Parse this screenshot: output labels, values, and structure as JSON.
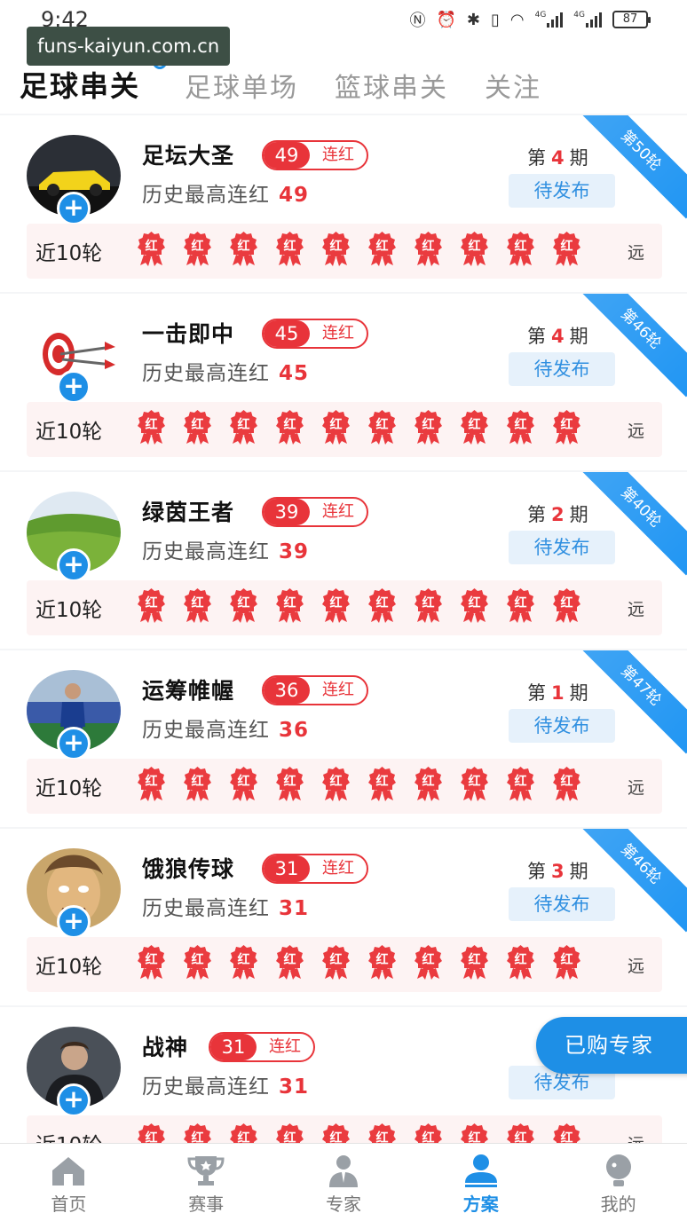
{
  "status_bar": {
    "time": "9:42",
    "battery": "87",
    "net1": "4G",
    "net2": "4G"
  },
  "watermark": "funs-kaiyun.com.cn",
  "tabs": [
    {
      "label": "足球串关",
      "active": true
    },
    {
      "label": "足球单场",
      "active": false
    },
    {
      "label": "篮球串关",
      "active": false
    },
    {
      "label": "关注",
      "active": false
    }
  ],
  "common": {
    "streak_label": "连红",
    "history_label": "历史最高连红",
    "period_prefix": "第",
    "period_suffix": "期",
    "publish_label": "待发布",
    "recent_label": "近10轮",
    "medal_text": "红",
    "far_label": "远",
    "add_symbol": "+"
  },
  "experts": [
    {
      "name": "足坛大圣",
      "streak": "49",
      "history_max": "49",
      "period": "4",
      "round": "第50轮",
      "avatar": "car"
    },
    {
      "name": "一击即中",
      "streak": "45",
      "history_max": "45",
      "period": "4",
      "round": "第46轮",
      "avatar": "target"
    },
    {
      "name": "绿茵王者",
      "streak": "39",
      "history_max": "39",
      "period": "2",
      "round": "第40轮",
      "avatar": "field"
    },
    {
      "name": "运筹帷幄",
      "streak": "36",
      "history_max": "36",
      "period": "1",
      "round": "第47轮",
      "avatar": "player"
    },
    {
      "name": "饿狼传球",
      "streak": "31",
      "history_max": "31",
      "period": "3",
      "round": "第46轮",
      "avatar": "cartoon"
    },
    {
      "name": "战神",
      "streak": "31",
      "history_max": "31",
      "period": "",
      "round": "",
      "avatar": "man"
    }
  ],
  "float_button": "已购专家",
  "nav": [
    {
      "label": "首页",
      "icon": "home-icon",
      "active": false
    },
    {
      "label": "赛事",
      "icon": "trophy-icon",
      "active": false
    },
    {
      "label": "专家",
      "icon": "expert-icon",
      "active": false
    },
    {
      "label": "方案",
      "icon": "plan-icon",
      "active": true
    },
    {
      "label": "我的",
      "icon": "profile-icon",
      "active": false
    }
  ],
  "colors": {
    "accent": "#1e8fe6",
    "red": "#e8343a",
    "ribbon": "#2196f3"
  }
}
